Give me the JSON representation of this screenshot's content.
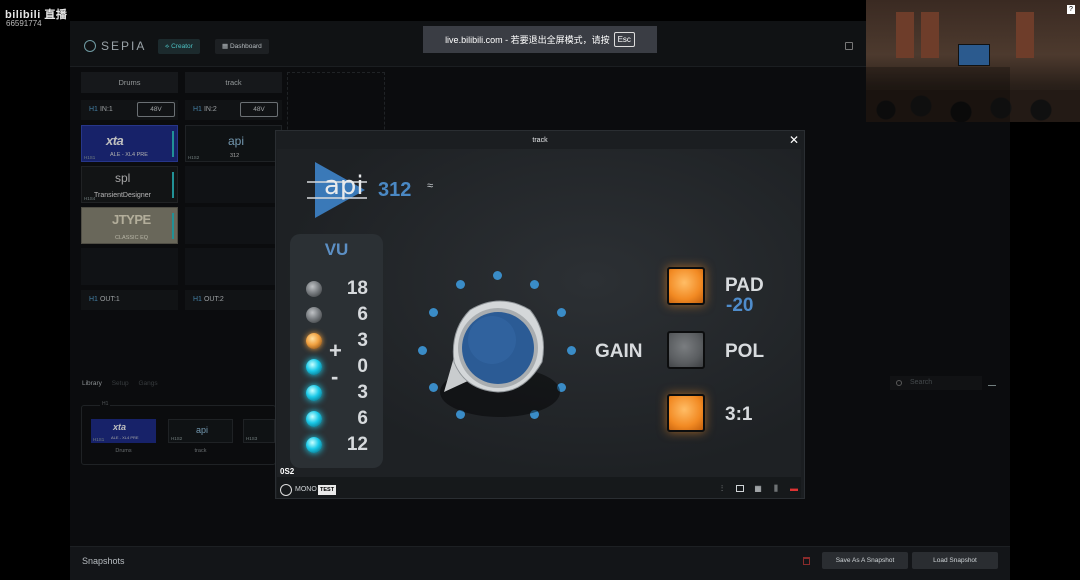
{
  "watermark": {
    "brand": "bilibili 直播",
    "id": "66591774"
  },
  "app": {
    "logo": "SEPIA",
    "tabs": [
      {
        "label": "Creator"
      },
      {
        "label": "Dashboard"
      }
    ]
  },
  "toast": {
    "text": "live.bilibili.com - 若要退出全屏模式，请按",
    "key": "Esc"
  },
  "pip": {
    "badge": "?"
  },
  "channels": [
    {
      "name": "Drums",
      "input": "IN:1",
      "hw": "H1",
      "phantom": "48V",
      "output": "OUT:1"
    },
    {
      "name": "track",
      "input": "IN:2",
      "hw": "H1",
      "phantom": "48V",
      "output": "OUT:2"
    }
  ],
  "plugins": {
    "xta": {
      "brand": "xta",
      "model": "ALE - XL4 PRE",
      "tag": "H1S1"
    },
    "api": {
      "brand": "api",
      "model": "312",
      "tag": "H1S2"
    },
    "spl": {
      "brand": "spl",
      "model": "TransientDesigner",
      "tag": "H1S4"
    },
    "jtype": {
      "brand": "JTYPE",
      "model": "CLASSIC EQ"
    }
  },
  "library": {
    "tabs": [
      "Library",
      "Setup",
      "Gangs"
    ],
    "search_placeholder": "Search",
    "group_label": "H1",
    "items": [
      {
        "label": "Drums",
        "tag": "H1S1",
        "brand": "xta",
        "model": "ALE - XL4 PRE"
      },
      {
        "label": "track",
        "tag": "H1S2",
        "brand": "api"
      },
      {
        "tag": "H1S3"
      }
    ]
  },
  "snapshots": {
    "title": "Snapshots",
    "save": "Save As A Snapshot",
    "load": "Load Snapshot"
  },
  "modal": {
    "title": "track",
    "close": "✕",
    "plugin_brand": "api",
    "plugin_model": "312",
    "vu_title": "VU",
    "vu_scale": [
      "18",
      "6",
      "3",
      "0",
      "3",
      "6",
      "12"
    ],
    "vu_leds": [
      "off",
      "off",
      "orange",
      "cyan",
      "cyan",
      "cyan",
      "cyan"
    ],
    "plus": "+",
    "minus": "-",
    "gain_label": "GAIN",
    "pad_label": "PAD",
    "pad_value": "-20",
    "pol_label": "POL",
    "ratio_label": "3:1",
    "pad_on": true,
    "pol_on": false,
    "ratio_on": true,
    "footer_name": "0S2",
    "mono_label": "MONO",
    "test_label": "TEST"
  },
  "colors": {
    "accent": "#4dc1c3",
    "api_blue": "#4a88c4",
    "led_orange": "#f0a040",
    "led_cyan": "#19c9e8",
    "button_orange": "#f28a23"
  }
}
